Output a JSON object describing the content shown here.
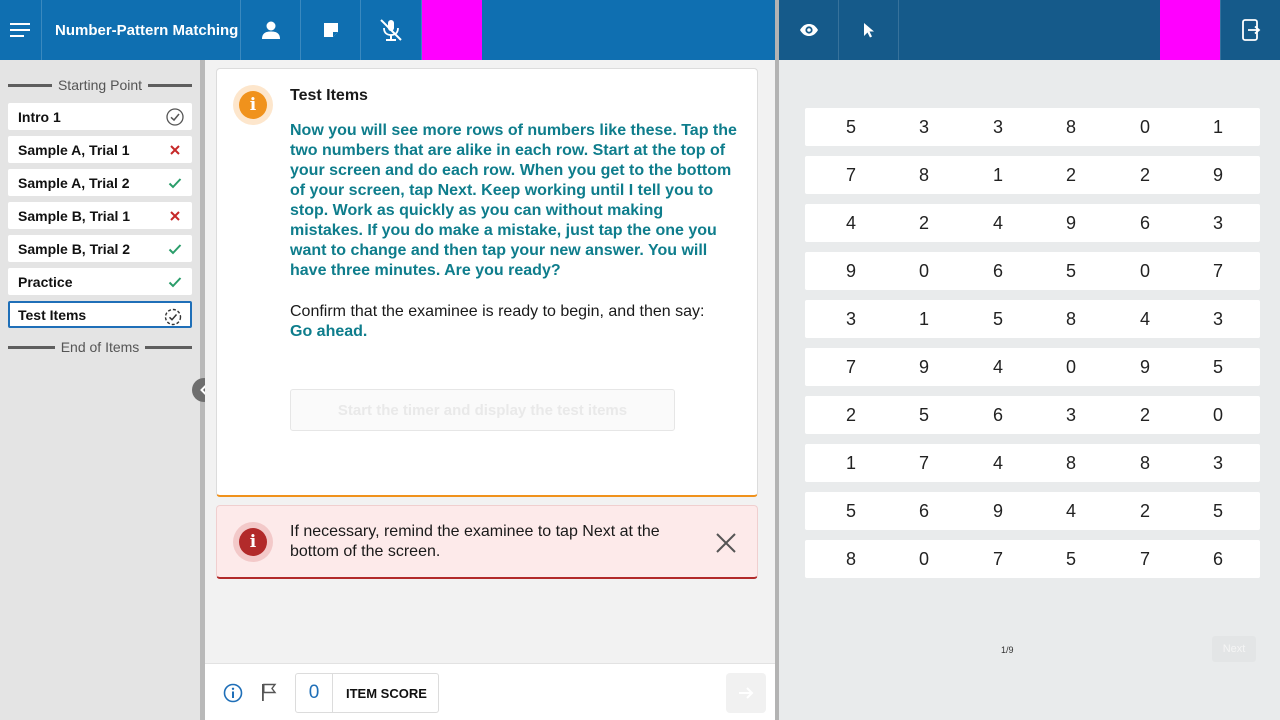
{
  "examiner": {
    "app_title": "Number-Pattern Matching",
    "icons": {
      "menu": "hamburger-menu-icon",
      "person": "person-icon",
      "note": "note-icon",
      "mic": "mic-muted-icon"
    },
    "sidebar": {
      "start_label": "Starting Point",
      "end_label": "End of Items",
      "items": [
        {
          "label": "Intro 1",
          "status": "check-circle"
        },
        {
          "label": "Sample A, Trial 1",
          "status": "x"
        },
        {
          "label": "Sample A, Trial 2",
          "status": "check"
        },
        {
          "label": "Sample B, Trial 1",
          "status": "x"
        },
        {
          "label": "Sample B, Trial 2",
          "status": "check"
        },
        {
          "label": "Practice",
          "status": "check"
        },
        {
          "label": "Test Items",
          "status": "in-progress"
        }
      ]
    },
    "card": {
      "icon_glyph": "i",
      "title": "Test Items",
      "say_text": "Now you will see more rows of numbers like these. Tap the two numbers that are alike in each row. Start at the top of your screen and do each row. When you get to the bottom of your screen, tap Next. Keep working until I tell you to stop. Work as quickly as you can without making mistakes. If you do make a mistake, just tap the one you want to change and then tap your new answer. You will have three minutes. Are you ready?",
      "confirm_text": "Confirm that the examinee is ready to begin, and then say:",
      "confirm_say": "Go ahead.",
      "start_button": "Start the timer and display the test items"
    },
    "alert": {
      "icon_glyph": "i",
      "text": "If necessary, remind the examinee to tap Next at the bottom of the screen."
    },
    "bottom": {
      "score_value": "0",
      "score_label": "ITEM SCORE"
    }
  },
  "examinee": {
    "icons": {
      "eye": "eye-icon",
      "pointer": "pointer-icon",
      "exit": "exit-icon"
    },
    "rows": [
      [
        "5",
        "3",
        "3",
        "8",
        "0",
        "1"
      ],
      [
        "7",
        "8",
        "1",
        "2",
        "2",
        "9"
      ],
      [
        "4",
        "2",
        "4",
        "9",
        "6",
        "3"
      ],
      [
        "9",
        "0",
        "6",
        "5",
        "0",
        "7"
      ],
      [
        "3",
        "1",
        "5",
        "8",
        "4",
        "3"
      ],
      [
        "7",
        "9",
        "4",
        "0",
        "9",
        "5"
      ],
      [
        "2",
        "5",
        "6",
        "3",
        "2",
        "0"
      ],
      [
        "1",
        "7",
        "4",
        "8",
        "8",
        "3"
      ],
      [
        "5",
        "6",
        "9",
        "4",
        "2",
        "5"
      ],
      [
        "8",
        "0",
        "7",
        "5",
        "7",
        "6"
      ]
    ],
    "page_indicator": "1/9",
    "next_label": "Next"
  },
  "colors": {
    "topbar": "#0f6fb1",
    "topbar_right": "#155a8a",
    "teal_text": "#0e7d8c",
    "orange": "#f0921c",
    "red": "#b22a2a",
    "magenta": "#ff00ff",
    "check_green": "#2a9d6a"
  }
}
